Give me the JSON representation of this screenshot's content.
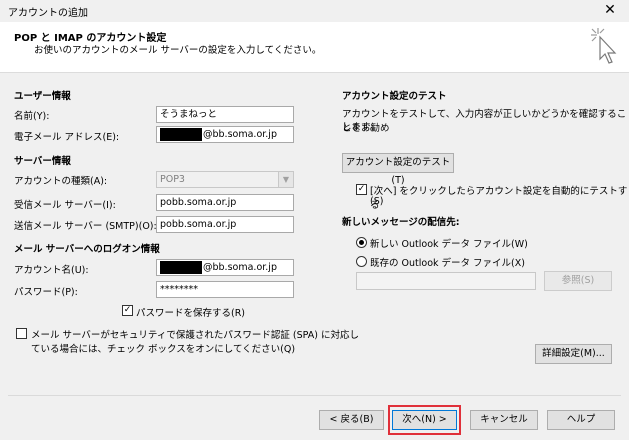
{
  "window": {
    "title": "アカウントの追加"
  },
  "header": {
    "title": "POP と IMAP のアカウント設定",
    "subtitle": "お使いのアカウントのメール サーバーの設定を入力してください。"
  },
  "user_info": {
    "heading": "ユーザー情報",
    "name_label": "名前(Y):",
    "name_value": "そうまねっと",
    "email_label": "電子メール アドレス(E):",
    "email_domain": "@bb.soma.or.jp"
  },
  "server_info": {
    "heading": "サーバー情報",
    "account_type_label": "アカウントの種類(A):",
    "account_type_value": "POP3",
    "incoming_label": "受信メール サーバー(I):",
    "incoming_value": "pobb.soma.or.jp",
    "outgoing_label": "送信メール サーバー (SMTP)(O):",
    "outgoing_value": "pobb.soma.or.jp"
  },
  "logon_info": {
    "heading": "メール サーバーへのログオン情報",
    "account_label": "アカウント名(U):",
    "account_domain": "@bb.soma.or.jp",
    "password_label": "パスワード(P):",
    "password_value": "********",
    "save_password_label": "パスワードを保存する(R)",
    "spa_label_line1": "メール サーバーがセキュリティで保護されたパスワード認証 (SPA) に対応し",
    "spa_label_line2": "ている場合には、チェック ボックスをオンにしてください(Q)"
  },
  "test": {
    "heading": "アカウント設定のテスト",
    "desc_line1": "アカウントをテストして、入力内容が正しいかどうかを確認することをお勧め",
    "desc_line2": "します。",
    "test_button": "アカウント設定のテスト(T)",
    "auto_test_line1": "[次へ] をクリックしたらアカウント設定を自動的にテストする",
    "auto_test_line2": "(S)"
  },
  "delivery": {
    "heading": "新しいメッセージの配信先:",
    "new_file_label": "新しい Outlook データ ファイル(W)",
    "existing_file_label": "既存の Outlook データ ファイル(X)",
    "browse_button": "参照(S)"
  },
  "buttons": {
    "more_settings": "詳細設定(M)...",
    "back": "< 戻る(B)",
    "next": "次へ(N) >",
    "cancel": "キャンセル",
    "help": "ヘルプ"
  }
}
